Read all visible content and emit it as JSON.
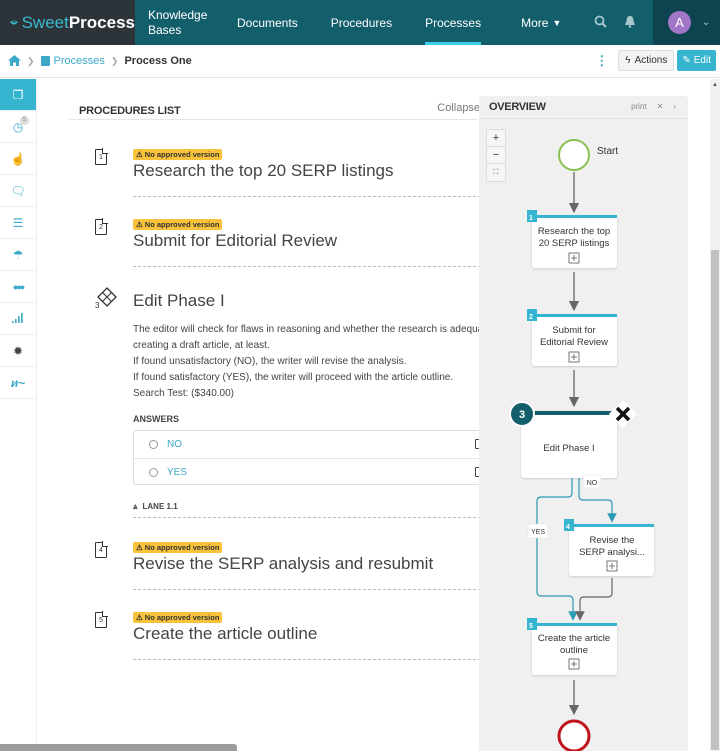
{
  "brand": {
    "sweet": "Sweet",
    "process": "Process"
  },
  "nav": {
    "items": [
      {
        "label": "Knowledge Bases",
        "active": false
      },
      {
        "label": "Documents",
        "active": false
      },
      {
        "label": "Procedures",
        "active": false
      },
      {
        "label": "Processes",
        "active": true
      },
      {
        "label": "More ❯",
        "active": false
      }
    ],
    "more_label": "More",
    "icons": [
      "search-icon",
      "bell-icon"
    ],
    "user_initial": "A"
  },
  "breadcrumb": {
    "home_icon": "home-icon",
    "items": [
      "Processes",
      "Process One"
    ],
    "actions_label": "Actions",
    "edit_label": "Edit"
  },
  "sidebar": {
    "items": [
      {
        "icon": "documents-icon",
        "glyph": "❐",
        "active": true
      },
      {
        "icon": "history-icon",
        "glyph": "◷",
        "badge": "5"
      },
      {
        "icon": "thumbs-up-icon",
        "glyph": "👍"
      },
      {
        "icon": "comments-icon",
        "glyph": "🗨"
      },
      {
        "icon": "checklist-icon",
        "glyph": "☰"
      },
      {
        "icon": "umbrella-icon",
        "glyph": "☂"
      },
      {
        "icon": "team-icon",
        "glyph": "👥"
      },
      {
        "icon": "signal-icon",
        "glyph": "▂▄▆"
      },
      {
        "icon": "badge-icon",
        "glyph": "✹"
      },
      {
        "icon": "signature-icon",
        "glyph": "〰"
      }
    ]
  },
  "procedures_list": {
    "title": "PROCEDURES LIST",
    "collapse_label": "Collapse All ⌃",
    "warning_label": "⚠ No approved version",
    "steps": [
      {
        "number": "1",
        "title": "Research the top 20 SERP listings"
      },
      {
        "number": "2",
        "title": "Submit for Editorial Review"
      },
      {
        "number": "4",
        "title": "Revise the SERP analysis and resubmit"
      },
      {
        "number": "5",
        "title": "Create the article outline"
      }
    ],
    "decision": {
      "number": "3",
      "title": "Edit Phase I",
      "description_lines": [
        "The editor will check for flaws in reasoning and whether the research is adequate for creating a draft article, at least.",
        "If found unsatisfactory (NO), the writer will revise the analysis.",
        "If found satisfactory (YES), the writer will proceed with the article outline.",
        "Search Test: ($340.00)"
      ],
      "answers_label": "ANSWERS",
      "answers": [
        "NO",
        "YES"
      ],
      "lane_label": "LANE 1.1"
    }
  },
  "overview": {
    "title": "OVERVIEW",
    "print_label": "print",
    "zoom_in": "+",
    "zoom_out": "−",
    "fit": "⛶",
    "start_label": "Start",
    "nodes": [
      {
        "number": "1",
        "lines": [
          "Research the top",
          "20 SERP listings"
        ]
      },
      {
        "number": "2",
        "lines": [
          "Submit for",
          "Editorial Review"
        ]
      },
      {
        "number": "3",
        "lines": [
          "Edit Phase I"
        ]
      },
      {
        "number": "4",
        "lines": [
          "Revise the",
          "SERP analysi..."
        ]
      },
      {
        "number": "5",
        "lines": [
          "Create the article",
          "outline"
        ]
      }
    ],
    "branch_no": "NO",
    "branch_yes": "YES"
  },
  "colors": {
    "nav_bg": "#135e6b",
    "brand_bg": "#2d3439",
    "accent": "#35b5cf",
    "warning": "#f8c23a",
    "start_green": "#8cc152",
    "end_red": "#c0141c",
    "decision_dark": "#135e6b"
  }
}
